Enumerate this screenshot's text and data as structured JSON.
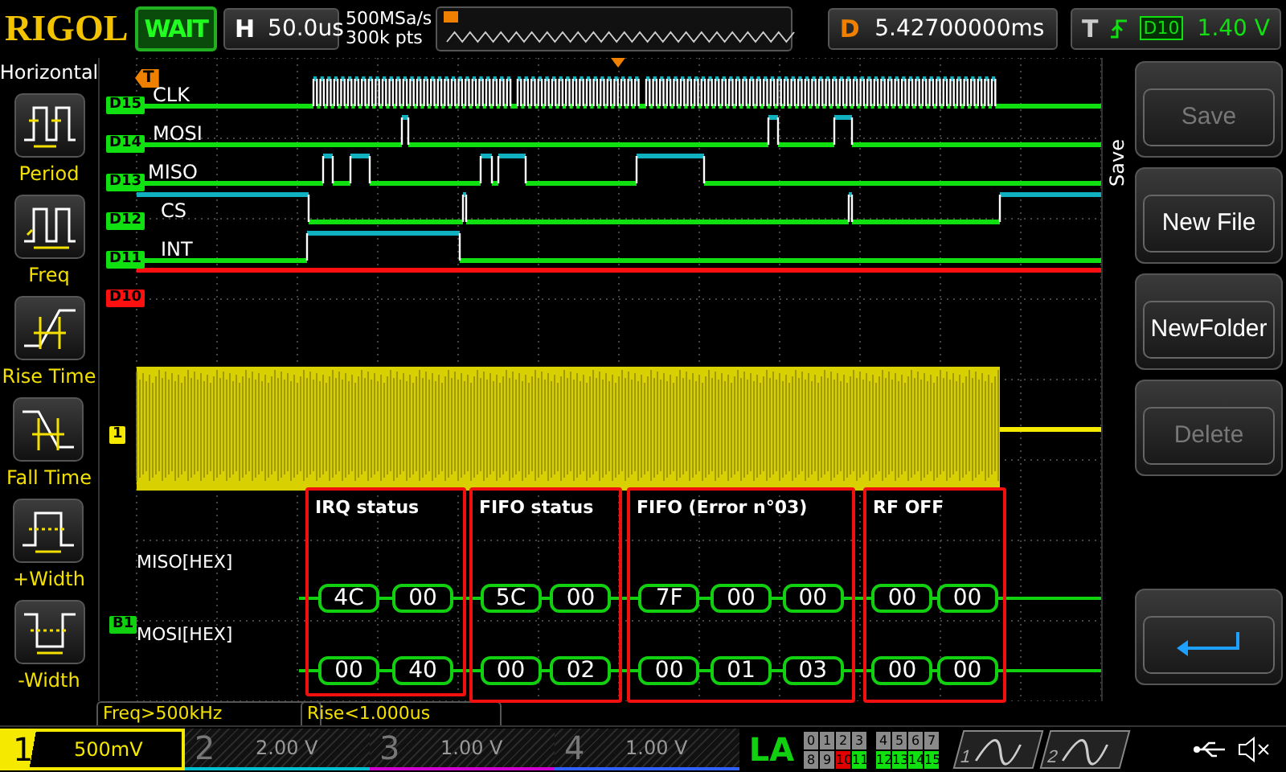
{
  "brand": "RIGOL",
  "run_status": "WAIT",
  "timebase": {
    "label": "H",
    "value": "50.0us"
  },
  "acquisition": {
    "sample_rate": "500MSa/s",
    "memory_depth": "300k pts"
  },
  "delay": {
    "label": "D",
    "value": "5.42700000ms"
  },
  "trigger": {
    "label": "T",
    "source": "D10",
    "level": "1.40 V"
  },
  "measure_menu": {
    "title": "Horizontal",
    "items": [
      {
        "kind": "period",
        "label": "Period"
      },
      {
        "kind": "freq",
        "label": "Freq"
      },
      {
        "kind": "rise",
        "label": "Rise Time"
      },
      {
        "kind": "fall",
        "label": "Fall Time"
      },
      {
        "kind": "pwidth",
        "label": "+Width"
      },
      {
        "kind": "nwidth",
        "label": "-Width"
      }
    ]
  },
  "trigger_marker": {
    "label": "T"
  },
  "digital_channels": [
    {
      "tag": "D15",
      "label": "CLK",
      "color": "#10e010"
    },
    {
      "tag": "D14",
      "label": "MOSI",
      "color": "#10e010"
    },
    {
      "tag": "D13",
      "label": "MISO",
      "color": "#10e010"
    },
    {
      "tag": "D12",
      "label": "CS",
      "color": "#10e010"
    },
    {
      "tag": "D11",
      "label": "INT",
      "color": "#10e010"
    },
    {
      "tag": "D10",
      "color": "#ff1010"
    }
  ],
  "analog_channel": {
    "tag": "1"
  },
  "bus": {
    "tag": "B1",
    "lines": [
      {
        "label": "MISO[HEX]"
      },
      {
        "label": "MOSI[HEX]"
      }
    ]
  },
  "decode_groups": [
    {
      "title": "IRQ status",
      "miso": [
        "4C",
        "00"
      ],
      "mosi": [
        "00",
        "40"
      ]
    },
    {
      "title": "FIFO status",
      "miso": [
        "5C",
        "00"
      ],
      "mosi": [
        "00",
        "02"
      ]
    },
    {
      "title": "FIFO (Error n°03)",
      "miso": [
        "7F",
        "00",
        "00"
      ],
      "mosi": [
        "00",
        "01",
        "03"
      ]
    },
    {
      "title": "RF OFF",
      "miso": [
        "00",
        "00"
      ],
      "mosi": [
        "00",
        "00"
      ]
    }
  ],
  "measurements": [
    "Freq>500kHz",
    "Rise<1.000us"
  ],
  "file_menu": {
    "title": "Save",
    "buttons": [
      {
        "kind": "text",
        "label": "Save",
        "disabled": true
      },
      {
        "kind": "text",
        "label": "New File",
        "disabled": false
      },
      {
        "kind": "text",
        "label": "NewFolder",
        "disabled": false
      },
      {
        "kind": "text",
        "label": "Delete",
        "disabled": true
      },
      {
        "kind": "return"
      }
    ]
  },
  "channels": [
    {
      "number": "1",
      "scale": "500mV",
      "active": true,
      "color": "#f5e900"
    },
    {
      "number": "2",
      "scale": "2.00 V",
      "active": false,
      "color": "#00c0d0"
    },
    {
      "number": "3",
      "scale": "1.00 V",
      "active": false,
      "color": "#d000d0"
    },
    {
      "number": "4",
      "scale": "1.00 V",
      "active": false,
      "color": "#3060ff"
    }
  ],
  "logic_analyzer": {
    "label": "LA",
    "bits": [
      {
        "name": "0",
        "color": "#8a8a8a"
      },
      {
        "name": "1",
        "color": "#8a8a8a"
      },
      {
        "name": "2",
        "color": "#8a8a8a"
      },
      {
        "name": "3",
        "color": "#8a8a8a"
      },
      {
        "name": "4",
        "color": "#8a8a8a"
      },
      {
        "name": "5",
        "color": "#8a8a8a"
      },
      {
        "name": "6",
        "color": "#8a8a8a"
      },
      {
        "name": "7",
        "color": "#8a8a8a"
      },
      {
        "name": "8",
        "color": "#8a8a8a"
      },
      {
        "name": "9",
        "color": "#8a8a8a"
      },
      {
        "name": "10",
        "color": "#e00000"
      },
      {
        "name": "11",
        "color": "#10e010"
      },
      {
        "name": "12",
        "color": "#10e010"
      },
      {
        "name": "13",
        "color": "#10e010"
      },
      {
        "name": "14",
        "color": "#10e010"
      },
      {
        "name": "15",
        "color": "#10e010"
      }
    ]
  },
  "generators": [
    {
      "number": "1"
    },
    {
      "number": "2"
    }
  ]
}
